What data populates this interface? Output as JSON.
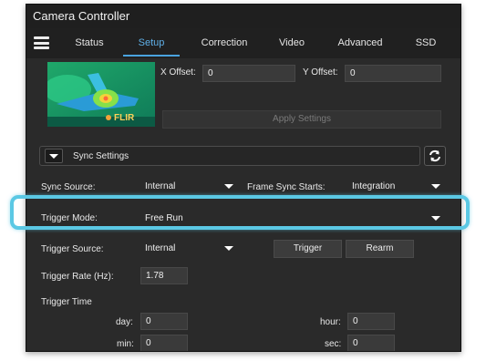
{
  "window": {
    "title": "Camera Controller"
  },
  "menu": {
    "tabs": [
      {
        "label": "Status"
      },
      {
        "label": "Setup",
        "active": true
      },
      {
        "label": "Correction"
      },
      {
        "label": "Video"
      },
      {
        "label": "Advanced"
      },
      {
        "label": "SSD"
      }
    ]
  },
  "preview": {
    "logo_text": "FLIR"
  },
  "offsets": {
    "x_label": "X Offset:",
    "x_value": "0",
    "y_label": "Y Offset:",
    "y_value": "0",
    "apply_label": "Apply Settings"
  },
  "sync": {
    "section_label": "Sync Settings",
    "sync_source_label": "Sync Source:",
    "sync_source_value": "Internal",
    "frame_sync_label": "Frame Sync Starts:",
    "frame_sync_value": "Integration"
  },
  "trigger": {
    "mode_label": "Trigger Mode:",
    "mode_value": "Free Run",
    "source_label": "Trigger Source:",
    "source_value": "Internal",
    "trigger_button": "Trigger",
    "rearm_button": "Rearm",
    "rate_label": "Trigger Rate (Hz):",
    "rate_value": "1.78",
    "time_label": "Trigger Time",
    "day_label": "day:",
    "day_value": "0",
    "hour_label": "hour:",
    "hour_value": "0",
    "min_label": "min:",
    "min_value": "0",
    "sec_label": "sec:",
    "sec_value": "0"
  },
  "colors": {
    "accent": "#4aa3df",
    "highlight": "#5bc8e4",
    "background": "#2a2a2a"
  },
  "icons": {
    "menu": "hamburger-icon",
    "collapse": "caret-down-icon",
    "refresh": "refresh-icon",
    "dropdown": "caret-down-icon"
  }
}
